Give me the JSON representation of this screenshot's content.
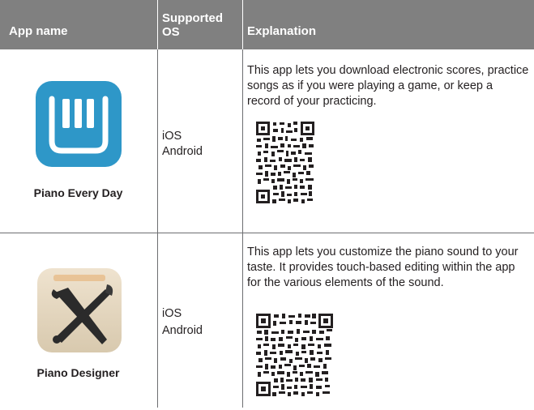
{
  "table": {
    "headers": {
      "app_name": "App name",
      "supported_os": "Supported OS",
      "explanation": "Explanation"
    },
    "rows": [
      {
        "app_name": "Piano Every Day",
        "icon": "piano-keys-icon",
        "os": [
          "iOS",
          "Android"
        ],
        "explanation": "This app lets you download electronic scores, practice songs as if you were playing a game, or keep a record of your practicing.",
        "qr": "qr-code-icon"
      },
      {
        "app_name": "Piano Designer",
        "icon": "piano-designer-tools-icon",
        "os": [
          "iOS",
          "Android"
        ],
        "explanation": "This app lets you customize the piano sound to your taste. It provides touch-based editing within the app for the various elements of the sound.",
        "qr": "qr-code-icon"
      }
    ]
  },
  "colors": {
    "header_bg": "#808080",
    "header_text": "#ffffff",
    "piano_icon_blue": "#2e97c8",
    "grid_line": "#6d6e71"
  }
}
